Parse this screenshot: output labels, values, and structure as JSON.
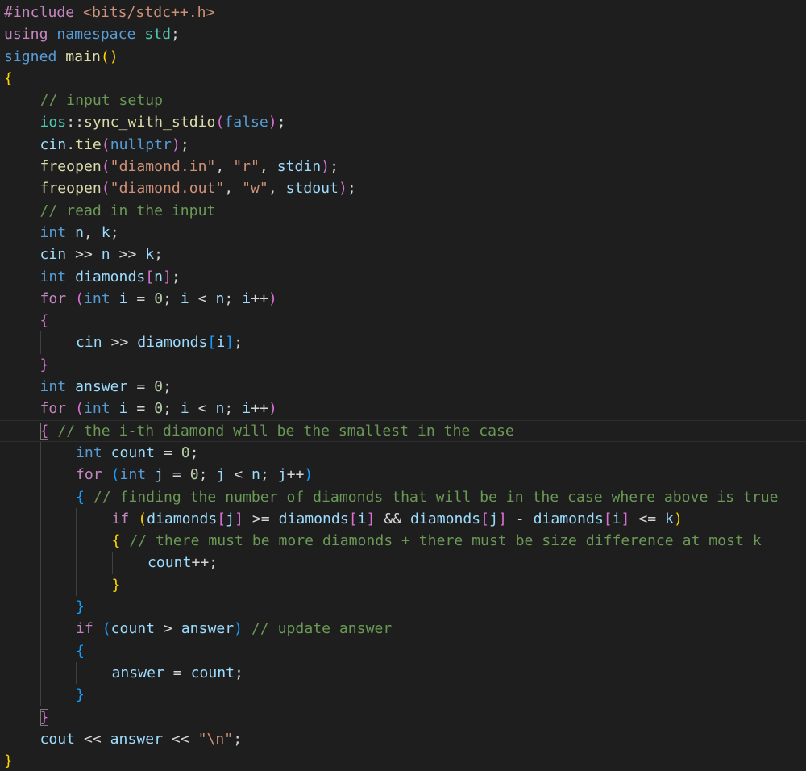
{
  "editor": {
    "language": "cpp",
    "colors": {
      "background": "#1e1e1e",
      "keyword": "#569cd6",
      "control": "#c586c0",
      "function": "#dcdcaa",
      "variable": "#9cdcfe",
      "string": "#ce9178",
      "number": "#b5cea8",
      "comment": "#6a9955",
      "namespace": "#4ec9b0",
      "bracket_1": "#ffd700",
      "bracket_2": "#da70d6",
      "bracket_3": "#179fff"
    },
    "lines": [
      {
        "indent": 0,
        "tokens": [
          [
            "pp",
            "#include"
          ],
          [
            "txt",
            " "
          ],
          [
            "inc",
            "<bits/stdc++.h>"
          ]
        ]
      },
      {
        "indent": 0,
        "tokens": [
          [
            "ctl",
            "using"
          ],
          [
            "txt",
            " "
          ],
          [
            "kw",
            "namespace"
          ],
          [
            "txt",
            " "
          ],
          [
            "ns",
            "std"
          ],
          [
            "op",
            ";"
          ]
        ]
      },
      {
        "indent": 0,
        "tokens": [
          [
            "kw",
            "signed"
          ],
          [
            "txt",
            " "
          ],
          [
            "fn",
            "main"
          ],
          [
            "b1",
            "()"
          ]
        ]
      },
      {
        "indent": 0,
        "tokens": [
          [
            "b1",
            "{"
          ]
        ]
      },
      {
        "indent": 1,
        "tokens": [
          [
            "cm",
            "// input setup"
          ]
        ]
      },
      {
        "indent": 1,
        "tokens": [
          [
            "ns",
            "ios"
          ],
          [
            "op",
            "::"
          ],
          [
            "fn",
            "sync_with_stdio"
          ],
          [
            "b2",
            "("
          ],
          [
            "kw",
            "false"
          ],
          [
            "b2",
            ")"
          ],
          [
            "op",
            ";"
          ]
        ]
      },
      {
        "indent": 1,
        "tokens": [
          [
            "var",
            "cin"
          ],
          [
            "op",
            "."
          ],
          [
            "fn",
            "tie"
          ],
          [
            "b2",
            "("
          ],
          [
            "kw",
            "nullptr"
          ],
          [
            "b2",
            ")"
          ],
          [
            "op",
            ";"
          ]
        ]
      },
      {
        "indent": 1,
        "tokens": [
          [
            "fn",
            "freopen"
          ],
          [
            "b2",
            "("
          ],
          [
            "str",
            "\"diamond.in\""
          ],
          [
            "op",
            ", "
          ],
          [
            "str",
            "\"r\""
          ],
          [
            "op",
            ", "
          ],
          [
            "var",
            "stdin"
          ],
          [
            "b2",
            ")"
          ],
          [
            "op",
            ";"
          ]
        ]
      },
      {
        "indent": 1,
        "tokens": [
          [
            "fn",
            "freopen"
          ],
          [
            "b2",
            "("
          ],
          [
            "str",
            "\"diamond.out\""
          ],
          [
            "op",
            ", "
          ],
          [
            "str",
            "\"w\""
          ],
          [
            "op",
            ", "
          ],
          [
            "var",
            "stdout"
          ],
          [
            "b2",
            ")"
          ],
          [
            "op",
            ";"
          ]
        ]
      },
      {
        "indent": 1,
        "tokens": [
          [
            "cm",
            "// read in the input"
          ]
        ]
      },
      {
        "indent": 1,
        "tokens": [
          [
            "ty",
            "int"
          ],
          [
            "txt",
            " "
          ],
          [
            "var",
            "n"
          ],
          [
            "op",
            ", "
          ],
          [
            "var",
            "k"
          ],
          [
            "op",
            ";"
          ]
        ]
      },
      {
        "indent": 1,
        "tokens": [
          [
            "var",
            "cin"
          ],
          [
            "op",
            " >> "
          ],
          [
            "var",
            "n"
          ],
          [
            "op",
            " >> "
          ],
          [
            "var",
            "k"
          ],
          [
            "op",
            ";"
          ]
        ]
      },
      {
        "indent": 1,
        "tokens": [
          [
            "ty",
            "int"
          ],
          [
            "txt",
            " "
          ],
          [
            "var",
            "diamonds"
          ],
          [
            "b2",
            "["
          ],
          [
            "var",
            "n"
          ],
          [
            "b2",
            "]"
          ],
          [
            "op",
            ";"
          ]
        ]
      },
      {
        "indent": 1,
        "tokens": [
          [
            "ctl",
            "for"
          ],
          [
            "txt",
            " "
          ],
          [
            "b2",
            "("
          ],
          [
            "ty",
            "int"
          ],
          [
            "txt",
            " "
          ],
          [
            "var",
            "i"
          ],
          [
            "op",
            " = "
          ],
          [
            "num",
            "0"
          ],
          [
            "op",
            "; "
          ],
          [
            "var",
            "i"
          ],
          [
            "op",
            " < "
          ],
          [
            "var",
            "n"
          ],
          [
            "op",
            "; "
          ],
          [
            "var",
            "i"
          ],
          [
            "op",
            "++"
          ],
          [
            "b2",
            ")"
          ]
        ]
      },
      {
        "indent": 1,
        "tokens": [
          [
            "b2",
            "{"
          ]
        ]
      },
      {
        "indent": 2,
        "tokens": [
          [
            "var",
            "cin"
          ],
          [
            "op",
            " >> "
          ],
          [
            "var",
            "diamonds"
          ],
          [
            "b3",
            "["
          ],
          [
            "var",
            "i"
          ],
          [
            "b3",
            "]"
          ],
          [
            "op",
            ";"
          ]
        ]
      },
      {
        "indent": 1,
        "tokens": [
          [
            "b2",
            "}"
          ]
        ]
      },
      {
        "indent": 1,
        "tokens": [
          [
            "ty",
            "int"
          ],
          [
            "txt",
            " "
          ],
          [
            "var",
            "answer"
          ],
          [
            "op",
            " = "
          ],
          [
            "num",
            "0"
          ],
          [
            "op",
            ";"
          ]
        ]
      },
      {
        "indent": 1,
        "tokens": [
          [
            "ctl",
            "for"
          ],
          [
            "txt",
            " "
          ],
          [
            "b2",
            "("
          ],
          [
            "ty",
            "int"
          ],
          [
            "txt",
            " "
          ],
          [
            "var",
            "i"
          ],
          [
            "op",
            " = "
          ],
          [
            "num",
            "0"
          ],
          [
            "op",
            "; "
          ],
          [
            "var",
            "i"
          ],
          [
            "op",
            " < "
          ],
          [
            "var",
            "n"
          ],
          [
            "op",
            "; "
          ],
          [
            "var",
            "i"
          ],
          [
            "op",
            "++"
          ],
          [
            "b2",
            ")"
          ]
        ]
      },
      {
        "indent": 1,
        "active": true,
        "tokens": [
          [
            "b2",
            "{",
            "match"
          ],
          [
            "txt",
            " "
          ],
          [
            "cm",
            "// the i-th diamond will be the smallest in the case"
          ]
        ]
      },
      {
        "indent": 2,
        "tokens": [
          [
            "ty",
            "int"
          ],
          [
            "txt",
            " "
          ],
          [
            "var",
            "count"
          ],
          [
            "op",
            " = "
          ],
          [
            "num",
            "0"
          ],
          [
            "op",
            ";"
          ]
        ]
      },
      {
        "indent": 2,
        "tokens": [
          [
            "ctl",
            "for"
          ],
          [
            "txt",
            " "
          ],
          [
            "b3",
            "("
          ],
          [
            "ty",
            "int"
          ],
          [
            "txt",
            " "
          ],
          [
            "var",
            "j"
          ],
          [
            "op",
            " = "
          ],
          [
            "num",
            "0"
          ],
          [
            "op",
            "; "
          ],
          [
            "var",
            "j"
          ],
          [
            "op",
            " < "
          ],
          [
            "var",
            "n"
          ],
          [
            "op",
            "; "
          ],
          [
            "var",
            "j"
          ],
          [
            "op",
            "++"
          ],
          [
            "b3",
            ")"
          ]
        ]
      },
      {
        "indent": 2,
        "tokens": [
          [
            "b3",
            "{"
          ],
          [
            "txt",
            " "
          ],
          [
            "cm",
            "// finding the number of diamonds that will be in the case where above is true"
          ]
        ]
      },
      {
        "indent": 3,
        "tokens": [
          [
            "ctl",
            "if"
          ],
          [
            "txt",
            " "
          ],
          [
            "b1",
            "("
          ],
          [
            "var",
            "diamonds"
          ],
          [
            "b2",
            "["
          ],
          [
            "var",
            "j"
          ],
          [
            "b2",
            "]"
          ],
          [
            "op",
            " >= "
          ],
          [
            "var",
            "diamonds"
          ],
          [
            "b2",
            "["
          ],
          [
            "var",
            "i"
          ],
          [
            "b2",
            "]"
          ],
          [
            "op",
            " && "
          ],
          [
            "var",
            "diamonds"
          ],
          [
            "b2",
            "["
          ],
          [
            "var",
            "j"
          ],
          [
            "b2",
            "]"
          ],
          [
            "op",
            " - "
          ],
          [
            "var",
            "diamonds"
          ],
          [
            "b2",
            "["
          ],
          [
            "var",
            "i"
          ],
          [
            "b2",
            "]"
          ],
          [
            "op",
            " <= "
          ],
          [
            "var",
            "k"
          ],
          [
            "b1",
            ")"
          ]
        ]
      },
      {
        "indent": 3,
        "tokens": [
          [
            "b1",
            "{"
          ],
          [
            "txt",
            " "
          ],
          [
            "cm",
            "// there must be more diamonds + there must be size difference at most k"
          ]
        ]
      },
      {
        "indent": 4,
        "tokens": [
          [
            "var",
            "count"
          ],
          [
            "op",
            "++;"
          ]
        ]
      },
      {
        "indent": 3,
        "tokens": [
          [
            "b1",
            "}"
          ]
        ]
      },
      {
        "indent": 2,
        "tokens": [
          [
            "b3",
            "}"
          ]
        ]
      },
      {
        "indent": 2,
        "tokens": [
          [
            "ctl",
            "if"
          ],
          [
            "txt",
            " "
          ],
          [
            "b3",
            "("
          ],
          [
            "var",
            "count"
          ],
          [
            "op",
            " > "
          ],
          [
            "var",
            "answer"
          ],
          [
            "b3",
            ")"
          ],
          [
            "txt",
            " "
          ],
          [
            "cm",
            "// update answer"
          ]
        ]
      },
      {
        "indent": 2,
        "tokens": [
          [
            "b3",
            "{"
          ]
        ]
      },
      {
        "indent": 3,
        "tokens": [
          [
            "var",
            "answer"
          ],
          [
            "op",
            " = "
          ],
          [
            "var",
            "count"
          ],
          [
            "op",
            ";"
          ]
        ]
      },
      {
        "indent": 2,
        "tokens": [
          [
            "b3",
            "}"
          ]
        ]
      },
      {
        "indent": 1,
        "tokens": [
          [
            "b2",
            "}",
            "match"
          ]
        ]
      },
      {
        "indent": 1,
        "tokens": [
          [
            "var",
            "cout"
          ],
          [
            "op",
            " << "
          ],
          [
            "var",
            "answer"
          ],
          [
            "op",
            " << "
          ],
          [
            "str",
            "\"\\n\""
          ],
          [
            "op",
            ";"
          ]
        ]
      },
      {
        "indent": 0,
        "tokens": [
          [
            "b1",
            "}"
          ]
        ]
      }
    ]
  }
}
